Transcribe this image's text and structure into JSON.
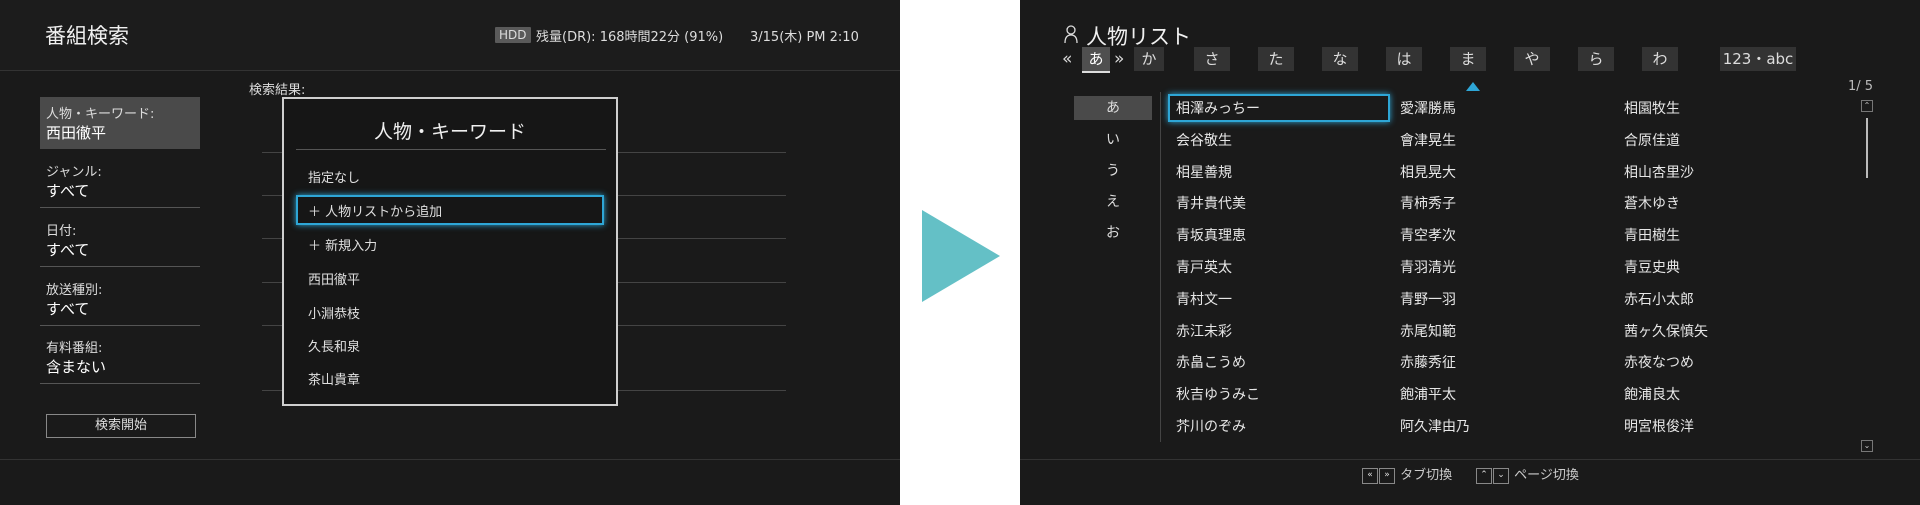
{
  "left_panel": {
    "title": "番組検索",
    "status": {
      "badge": "HDD",
      "remaining": "残量(DR): 168時間22分 (91%)",
      "datetime": "3/15(木) PM 2:10"
    },
    "fields": [
      {
        "label": "人物・キーワード:",
        "value": "西田徹平",
        "selected": true
      },
      {
        "label": "ジャンル:",
        "value": "すべて"
      },
      {
        "label": "日付:",
        "value": "すべて"
      },
      {
        "label": "放送種別:",
        "value": "すべて"
      },
      {
        "label": "有料番組:",
        "value": "含まない"
      }
    ],
    "search_button": "検索開始",
    "results_label": "検索結果:",
    "dialog": {
      "title": "人物・キーワード",
      "items": [
        "指定なし",
        "＋ 人物リストから追加",
        "＋ 新規入力",
        "西田徹平",
        "小淵恭枝",
        "久長和泉",
        "茶山貴章"
      ],
      "selected_index": 1
    }
  },
  "right_panel": {
    "title": "人物リスト",
    "tabs": [
      "あ",
      "か",
      "さ",
      "た",
      "な",
      "は",
      "ま",
      "や",
      "ら",
      "わ",
      "123・abc"
    ],
    "tab_prev": "«",
    "tab_next": "»",
    "active_tab": "あ",
    "page": "1/ 5",
    "kana": [
      "あ",
      "い",
      "う",
      "え",
      "お"
    ],
    "active_kana": "あ",
    "columns": [
      [
        "相澤みっちー",
        "会谷敬生",
        "相星善規",
        "青井貴代美",
        "青坂真理恵",
        "青戸英太",
        "青村文一",
        "赤江未彩",
        "赤畠こうめ",
        "秋吉ゆうみこ",
        "芥川のぞみ"
      ],
      [
        "愛澤勝馬",
        "會津晃生",
        "相見晃大",
        "青柿秀子",
        "青空孝次",
        "青羽清光",
        "青野一羽",
        "赤尾知範",
        "赤藤秀征",
        "飽浦平太",
        "阿久津由乃"
      ],
      [
        "相園牧生",
        "合原佳道",
        "相山杏里沙",
        "蒼木ゆき",
        "青田樹生",
        "青豆史典",
        "赤石小太郎",
        "茜ヶ久保慎矢",
        "赤夜なつめ",
        "飽浦良太",
        "明宮根俊洋"
      ]
    ],
    "selected_name": "相澤みっちー",
    "footer": {
      "tab_switch": "タブ切換",
      "page_switch": "ページ切換"
    }
  },
  "colors": {
    "background": "#1a1a1a",
    "focus": "#2ea6d6",
    "arrow": "#64c0c6"
  },
  "icons": {
    "person": "person-icon",
    "arrow": "right-arrow-icon"
  }
}
